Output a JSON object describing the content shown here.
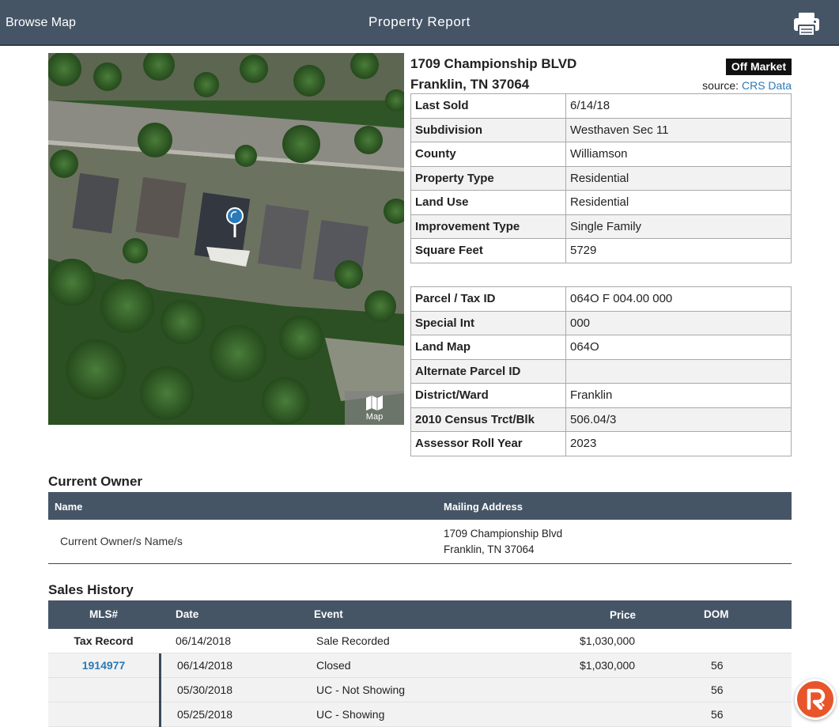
{
  "header": {
    "browse_label": "Browse Map",
    "title": "Property Report",
    "print_icon": "printer-icon"
  },
  "map": {
    "button_label": "Map",
    "button_icon": "map-icon",
    "pin_icon": "location-pin-icon"
  },
  "property": {
    "address_line1": "1709 Championship BLVD",
    "address_line2": "Franklin, TN 37064",
    "status": "Off Market",
    "source_label": "source:",
    "source_link": "CRS Data"
  },
  "details1": [
    {
      "label": "Last Sold",
      "value": "6/14/18"
    },
    {
      "label": "Subdivision",
      "value": "Westhaven Sec 11"
    },
    {
      "label": "County",
      "value": "Williamson"
    },
    {
      "label": "Property Type",
      "value": "Residential"
    },
    {
      "label": "Land Use",
      "value": "Residential"
    },
    {
      "label": "Improvement Type",
      "value": "Single Family"
    },
    {
      "label": "Square Feet",
      "value": "5729"
    }
  ],
  "details2": [
    {
      "label": "Parcel / Tax ID",
      "value": "064O F 004.00 000"
    },
    {
      "label": "Special Int",
      "value": "000"
    },
    {
      "label": "Land Map",
      "value": "064O"
    },
    {
      "label": "Alternate Parcel ID",
      "value": ""
    },
    {
      "label": "District/Ward",
      "value": "Franklin"
    },
    {
      "label": "2010 Census Trct/Blk",
      "value": "506.04/3"
    },
    {
      "label": "Assessor Roll Year",
      "value": "2023"
    }
  ],
  "owner": {
    "heading": "Current Owner",
    "col_name": "Name",
    "col_address": "Mailing Address",
    "name": "Current Owner/s Name/s",
    "address_line1": "1709 Championship Blvd",
    "address_line2": "Franklin, TN 37064"
  },
  "sales": {
    "heading": "Sales History",
    "columns": {
      "mls": "MLS#",
      "date": "Date",
      "event": "Event",
      "price": "Price",
      "dom": "DOM"
    },
    "rows": [
      {
        "mls": "Tax Record",
        "date": "06/14/2018",
        "event": "Sale Recorded",
        "price": "$1,030,000",
        "dom": ""
      },
      {
        "mls": "1914977",
        "date": "06/14/2018",
        "event": "Closed",
        "price": "$1,030,000",
        "dom": "56"
      },
      {
        "mls": "",
        "date": "05/30/2018",
        "event": "UC - Not Showing",
        "price": "",
        "dom": "56"
      },
      {
        "mls": "",
        "date": "05/25/2018",
        "event": "UC - Showing",
        "price": "",
        "dom": "56"
      }
    ]
  },
  "fab": {
    "icon": "brand-r-logo-icon"
  },
  "colors": {
    "header_bg": "#465566",
    "link": "#2a7ab8",
    "badge_bg": "#111111",
    "fab": "#e8552b"
  }
}
